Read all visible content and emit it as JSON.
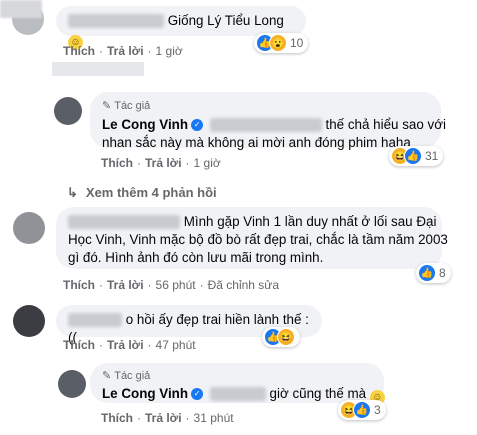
{
  "comments": [
    {
      "text_visible": "Giống Lý Tiểu Long",
      "actions": {
        "like": "Thích",
        "reply": "Trả lời",
        "time": "1 giờ"
      },
      "reactions": {
        "count": "10"
      }
    },
    {
      "author_tag": "Tác giả",
      "name": "Le Cong Vinh",
      "text_line1": "thế chả hiểu sao với",
      "text_line2": "nhan sắc này mà không ai mời anh đóng phim haha",
      "actions": {
        "like": "Thích",
        "reply": "Trả lời",
        "time": "1 giờ"
      },
      "reactions": {
        "count": "31"
      }
    },
    {
      "view_more": "Xem thêm 4 phản hồi"
    },
    {
      "text_line1": "Mình gặp Vinh 1 lần duy nhất ở lối sau Đại",
      "text_line2": "Học Vinh, Vinh mặc bộ đồ bò rất đẹp trai, chắc là tầm năm 2003",
      "text_line3": "gì đó. Hình ảnh đó còn lưu mãi trong mình.",
      "actions": {
        "like": "Thích",
        "reply": "Trả lời",
        "time": "56 phút",
        "edited": "Đã chỉnh sửa"
      },
      "reactions": {
        "count": "8"
      }
    },
    {
      "text_visible": "o hồi ấy đẹp trai hiền lành thế :((",
      "actions": {
        "like": "Thích",
        "reply": "Trả lời",
        "time": "47 phút"
      }
    },
    {
      "author_tag": "Tác giả",
      "name": "Le Cong Vinh",
      "text_visible": "giờ cũng thế mà",
      "actions": {
        "like": "Thích",
        "reply": "Trả lời",
        "time": "31 phút"
      },
      "reactions": {
        "count": "3"
      }
    }
  ]
}
